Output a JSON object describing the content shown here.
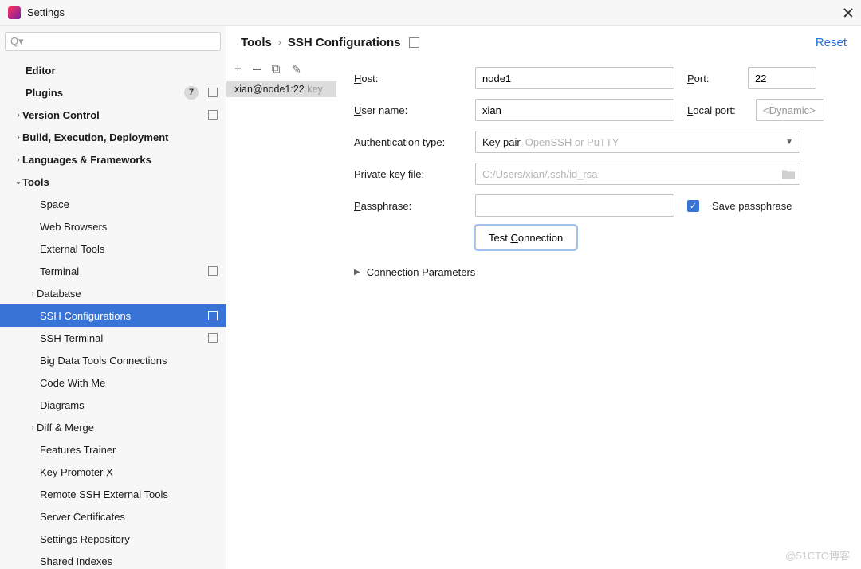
{
  "titlebar": {
    "title": "Settings"
  },
  "search": {
    "placeholder": ""
  },
  "tree": {
    "editor": "Editor",
    "plugins": "Plugins",
    "plugins_badge": "7",
    "version_control": "Version Control",
    "bed": "Build, Execution, Deployment",
    "lang_frameworks": "Languages & Frameworks",
    "tools": "Tools",
    "tools_children": {
      "space": "Space",
      "web_browsers": "Web Browsers",
      "external_tools": "External Tools",
      "terminal": "Terminal",
      "database": "Database",
      "ssh_configs": "SSH Configurations",
      "ssh_terminal": "SSH Terminal",
      "bigdata": "Big Data Tools Connections",
      "code_with_me": "Code With Me",
      "diagrams": "Diagrams",
      "diff_merge": "Diff & Merge",
      "features_trainer": "Features Trainer",
      "key_promoter": "Key Promoter X",
      "remote_ssh_ext": "Remote SSH External Tools",
      "server_certs": "Server Certificates",
      "settings_repo": "Settings Repository",
      "shared_indexes": "Shared Indexes"
    }
  },
  "breadcrumb": {
    "root": "Tools",
    "leaf": "SSH Configurations",
    "reset": "Reset"
  },
  "config_list": {
    "item_main": "xian@node1:22",
    "item_auth": " key"
  },
  "form": {
    "host_label": "Host:",
    "host_value": "node1",
    "port_label": "Port:",
    "port_value": "22",
    "user_label": "User name:",
    "user_value": "xian",
    "localport_label": "Local port:",
    "localport_value": "<Dynamic>",
    "auth_label": "Authentication type:",
    "auth_value": "Key pair",
    "auth_hint": "OpenSSH or PuTTY",
    "keyfile_label": "Private key file:",
    "keyfile_value": "C:/Users/xian/.ssh/id_rsa",
    "pass_label": "Passphrase:",
    "pass_value": "",
    "save_pass": "Save passphrase",
    "test_conn": "Test Connection",
    "conn_params": "Connection Parameters"
  },
  "watermark": "@51CTO博客"
}
